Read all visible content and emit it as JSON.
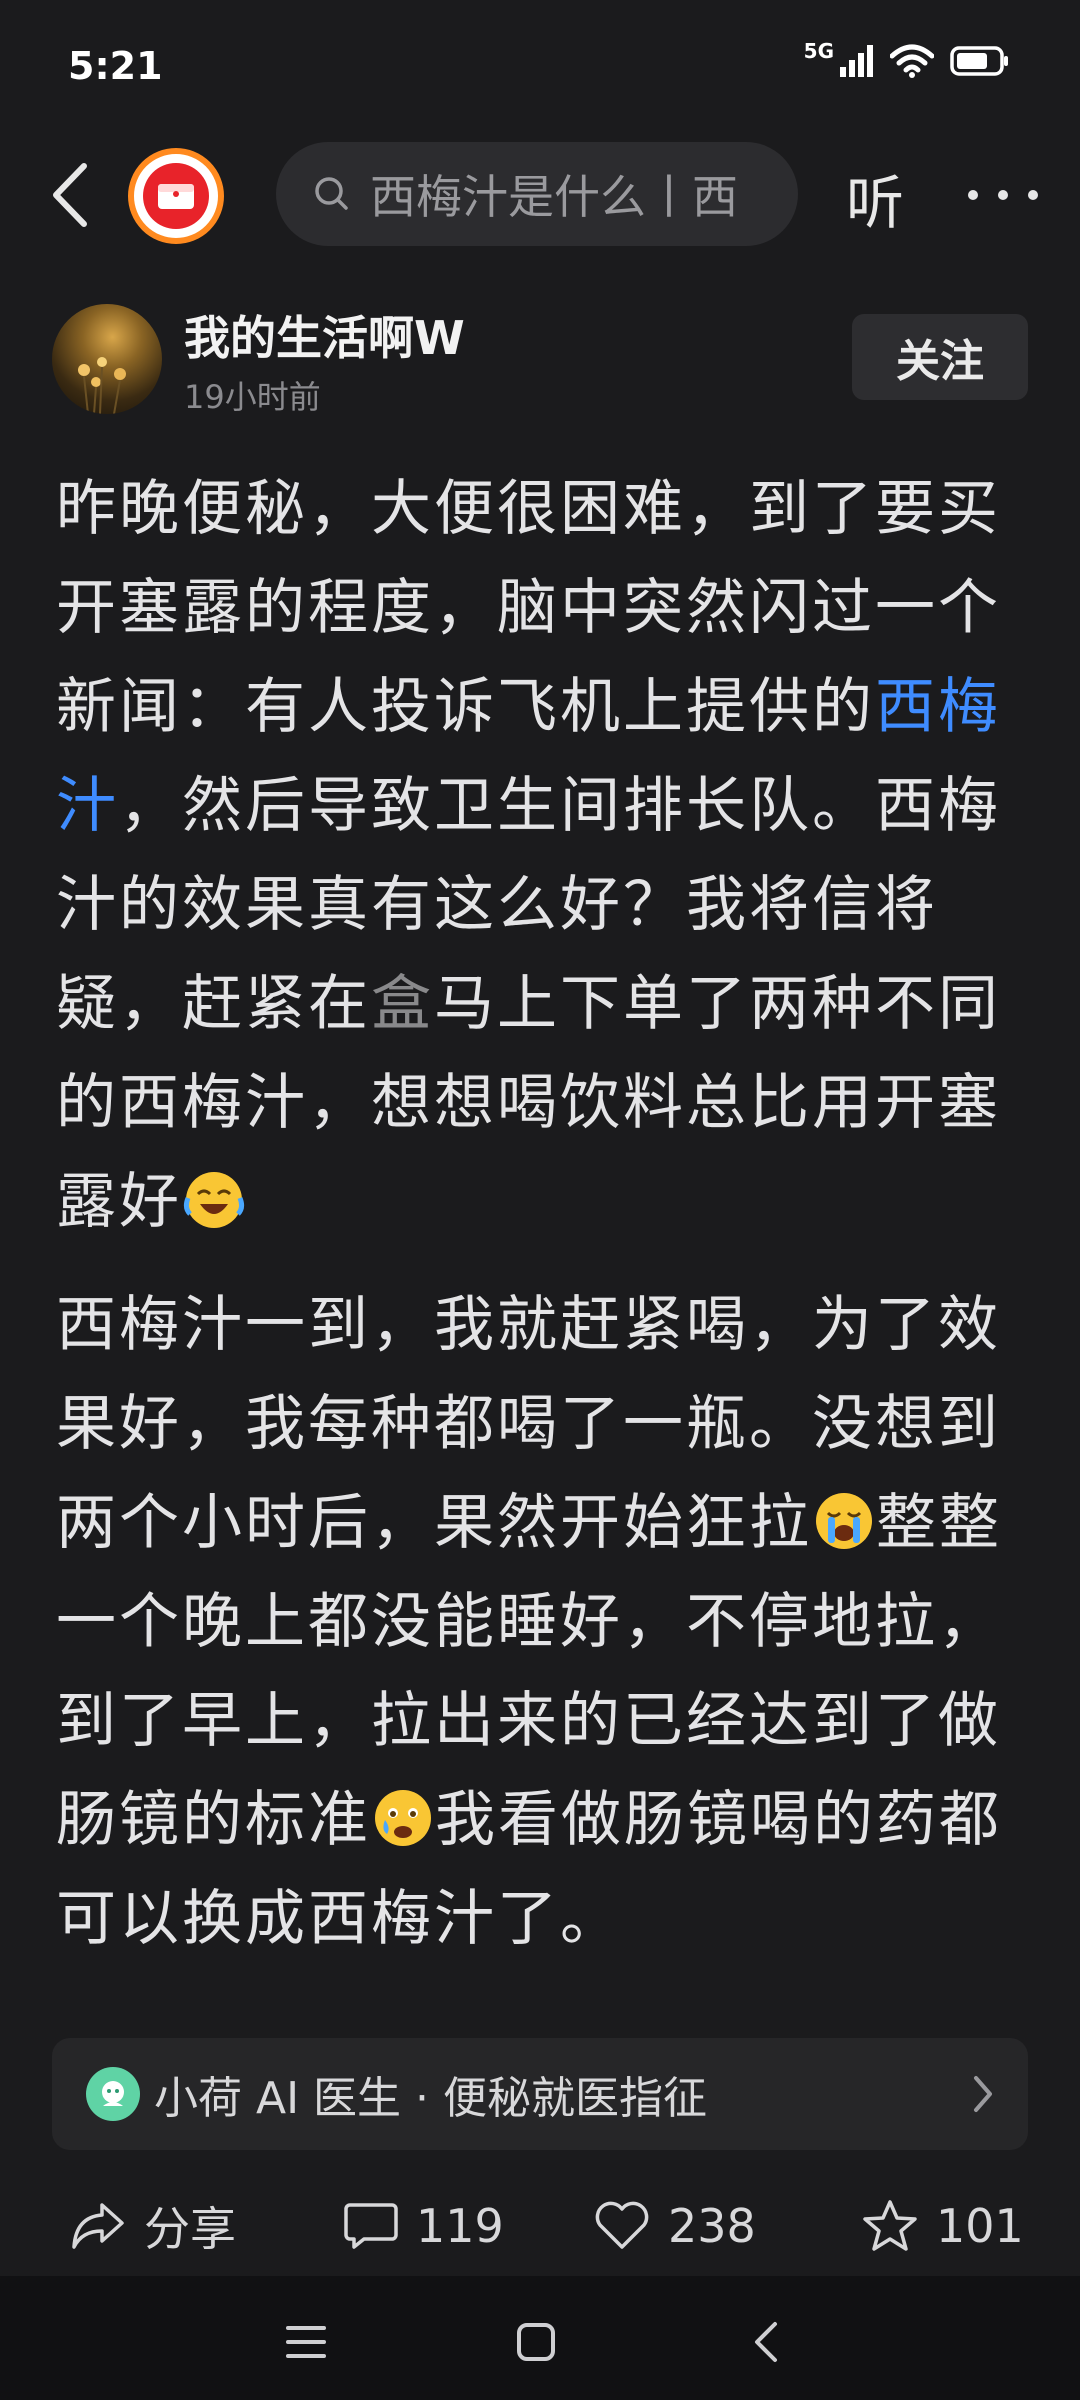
{
  "status_bar": {
    "time": "5:21",
    "network": "5G"
  },
  "nav": {
    "search_text": "西梅汁是什么丨西",
    "listen_label": "听"
  },
  "author": {
    "name": "我的生活啊W",
    "time": "19小时前",
    "follow_label": "关注"
  },
  "article": {
    "p1_a": "昨晚便秘，大便很困难，到了要买开塞露的程度，脑中突然闪过一个新闻：有人投诉飞机上提供的",
    "p1_kw": "西梅汁",
    "p1_b": "，然后导致卫生间排长队。西梅汁的效果真有这么好？我将信将疑，赶紧在",
    "p1_blur": "盒",
    "p1_c": "马上下单了两种不同的西梅汁，想想喝饮料总比用开塞露好",
    "p2_a": "西梅汁一到，我就赶紧喝，为了效果好，我每种都喝了一瓶。没想到两个小时后，果然开始狂拉",
    "p2_b": "整整一个晚上都没能睡好，不停地拉，到了早上，拉出来的已经达到了做肠镜的标准",
    "p2_c": "我看做肠镜喝的药都可以换成西梅汁了。"
  },
  "ai_card": {
    "label": "小荷 AI 医生 · 便秘就医指征"
  },
  "actions": {
    "share_label": "分享",
    "comments": "119",
    "likes": "238",
    "favorites": "101"
  },
  "icons": [
    "back-arrow-icon",
    "search-icon",
    "more-icon",
    "share-icon",
    "comment-icon",
    "heart-icon",
    "star-icon",
    "menu-icon",
    "home-icon",
    "nav-back-icon"
  ],
  "colors": {
    "background": "#1b1b1d",
    "keyword": "#3f8cff",
    "badge_ring": "#ff8a1f",
    "ai_icon": "#5fd3a5"
  }
}
